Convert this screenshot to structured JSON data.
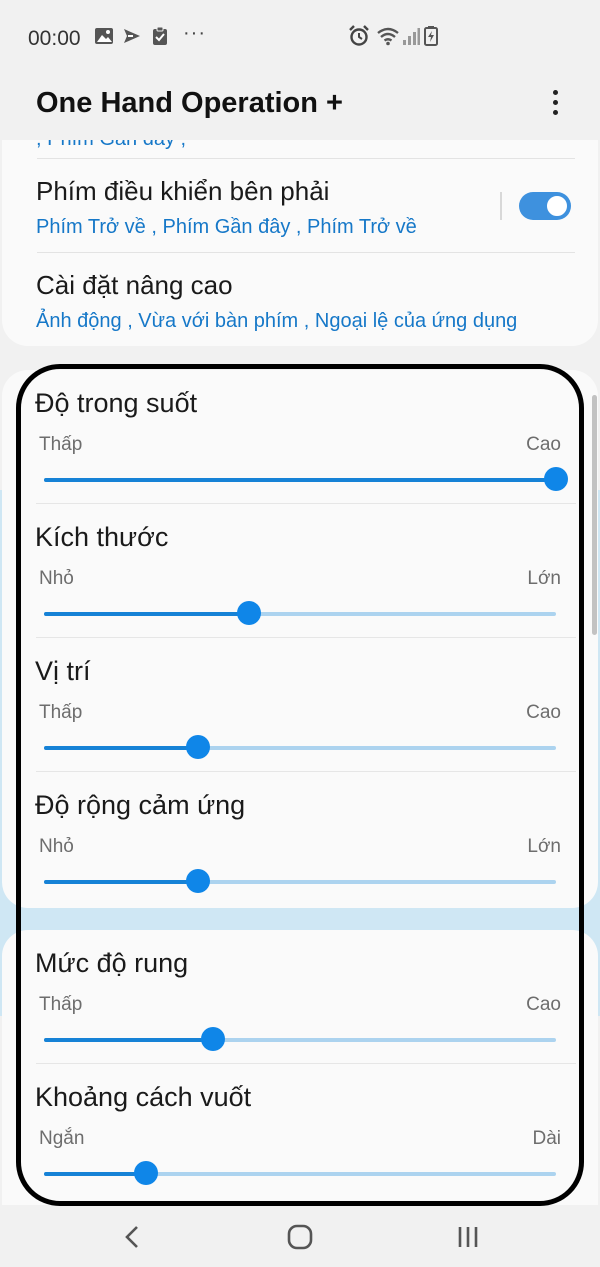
{
  "status_bar": {
    "time": "00:00",
    "dots": "···"
  },
  "header": {
    "title": "One Hand Operation +"
  },
  "settings": {
    "cut_text": ", Phím Gần đây ,",
    "right_keys": {
      "title": "Phím điều khiển bên phải",
      "subtitle": "Phím Trở về , Phím Gần đây , Phím Trở về",
      "enabled": true
    },
    "advanced": {
      "title": "Cài đặt nâng cao",
      "subtitle": "Ảnh động , Vừa với bàn phím , Ngoại lệ của ứng dụng"
    }
  },
  "sliders": [
    {
      "title": "Độ trong suốt",
      "min": "Thấp",
      "max": "Cao",
      "value": 1.0
    },
    {
      "title": "Kích thước",
      "min": "Nhỏ",
      "max": "Lớn",
      "value": 0.4
    },
    {
      "title": "Vị trí",
      "min": "Thấp",
      "max": "Cao",
      "value": 0.3
    },
    {
      "title": "Độ rộng cảm ứng",
      "min": "Nhỏ",
      "max": "Lớn",
      "value": 0.3
    },
    {
      "title": "Mức độ rung",
      "min": "Thấp",
      "max": "Cao",
      "value": 0.33
    },
    {
      "title": "Khoảng cách vuốt",
      "min": "Ngắn",
      "max": "Dài",
      "value": 0.2
    }
  ],
  "colors": {
    "accent": "#1682d6",
    "link": "#1678c8",
    "highlight": "#cfe7f4"
  }
}
